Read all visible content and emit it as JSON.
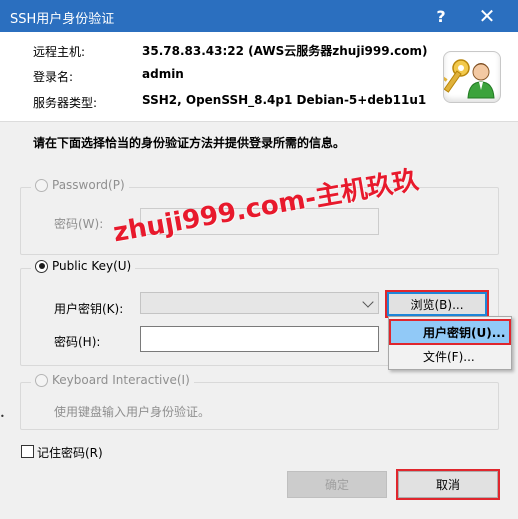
{
  "window": {
    "title": "SSH用户身份验证",
    "help_glyph": "?",
    "close_glyph": "✕",
    "accent_color": "#2b6fbf"
  },
  "info": {
    "host_label": "远程主机:",
    "host_value": "35.78.83.43:22 (AWS云服务器zhuji999.com)",
    "user_label": "登录名:",
    "user_value": "admin",
    "server_label": "服务器类型:",
    "server_value": "SSH2, OpenSSH_8.4p1 Debian-5+deb11u1",
    "icon": "user-key-icon"
  },
  "instruction": "请在下面选择恰当的身份验证方法并提供登录所需的信息。",
  "password_group": {
    "radio_label": "Password(P)",
    "password_label": "密码(W):",
    "password_value": ""
  },
  "publickey_group": {
    "radio_label": "Public Key(U)",
    "user_key_label": "用户密钥(K):",
    "user_key_value": "",
    "browse_label": "浏览(B)...",
    "passphrase_label": "密码(H):",
    "passphrase_value": ""
  },
  "browse_menu": {
    "items": [
      "用户密钥(U)...",
      "文件(F)..."
    ]
  },
  "keyboard_group": {
    "radio_label": "Keyboard Interactive(I)",
    "description": "使用键盘输入用户身份验证。"
  },
  "remember_password_label": "记住密码(R)",
  "buttons": {
    "ok": "确定",
    "cancel": "取消"
  },
  "watermark": "zhuji999.com-主机玖玖",
  "highlight_color": "#e0262d"
}
